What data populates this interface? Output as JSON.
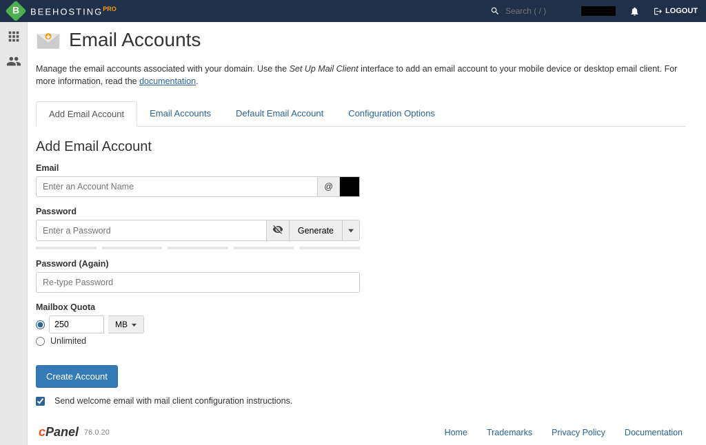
{
  "top": {
    "brand": "BEEHOSTING",
    "brand_suffix": "PRO",
    "search_placeholder": "Search ( / )",
    "logout": "LOGOUT"
  },
  "page": {
    "title": "Email Accounts",
    "intro_prefix": "Manage the email accounts associated with your domain. Use the ",
    "intro_em": "Set Up Mail Client",
    "intro_suffix": " interface to add an email account to your mobile device or desktop email client. For more information, read the ",
    "doc_link": "documentation",
    "intro_end": "."
  },
  "tabs": {
    "t0": "Add Email Account",
    "t1": "Email Accounts",
    "t2": "Default Email Account",
    "t3": "Configuration Options"
  },
  "form": {
    "section_title": "Add Email Account",
    "email_label": "Email",
    "email_placeholder": "Enter an Account Name",
    "at_symbol": "@",
    "password_label": "Password",
    "password_placeholder": "Enter a Password",
    "generate": "Generate",
    "password_again_label": "Password (Again)",
    "password_again_placeholder": "Re-type Password",
    "quota_label": "Mailbox Quota",
    "quota_value": "250",
    "quota_unit": "MB",
    "unlimited": "Unlimited",
    "create": "Create Account",
    "welcome_check": "Send welcome email with mail client configuration instructions."
  },
  "footer": {
    "cpanel_c": "c",
    "cpanel_rest": "Panel",
    "version": "76.0.20",
    "home": "Home",
    "trademarks": "Trademarks",
    "privacy": "Privacy Policy",
    "documentation": "Documentation"
  }
}
